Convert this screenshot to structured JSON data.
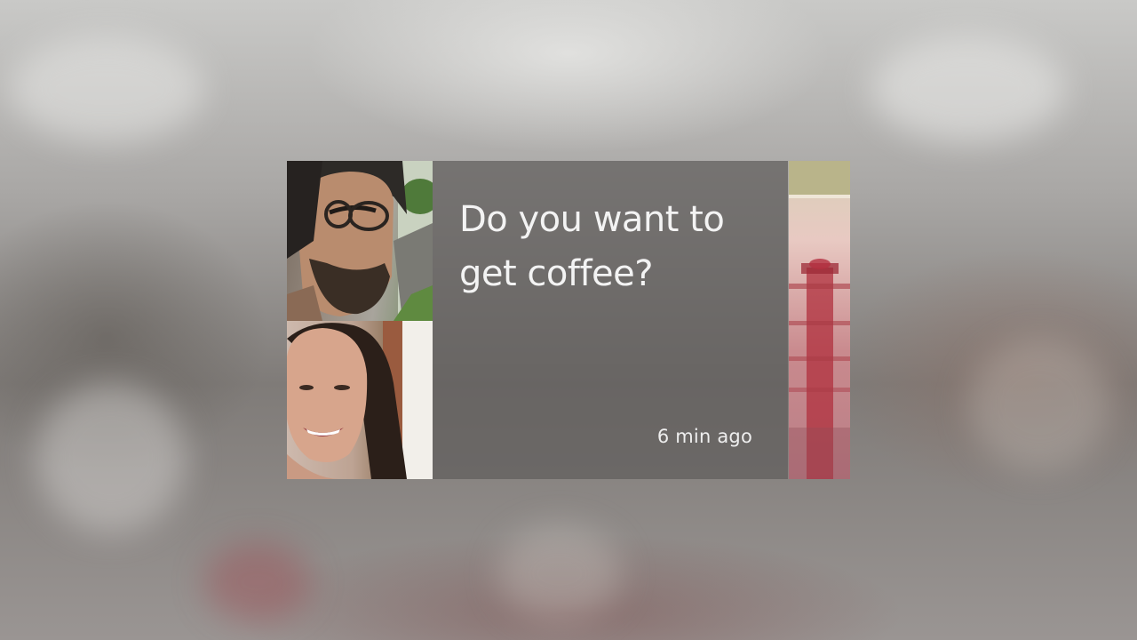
{
  "card": {
    "message": "Do you want to get coffee?",
    "timestamp": "6 min ago"
  },
  "contact_photos": [
    {
      "name": "man-with-glasses-icon"
    },
    {
      "name": "smiling-woman-icon"
    }
  ],
  "next_card_preview": {
    "icon": "lighthouse-icon"
  }
}
